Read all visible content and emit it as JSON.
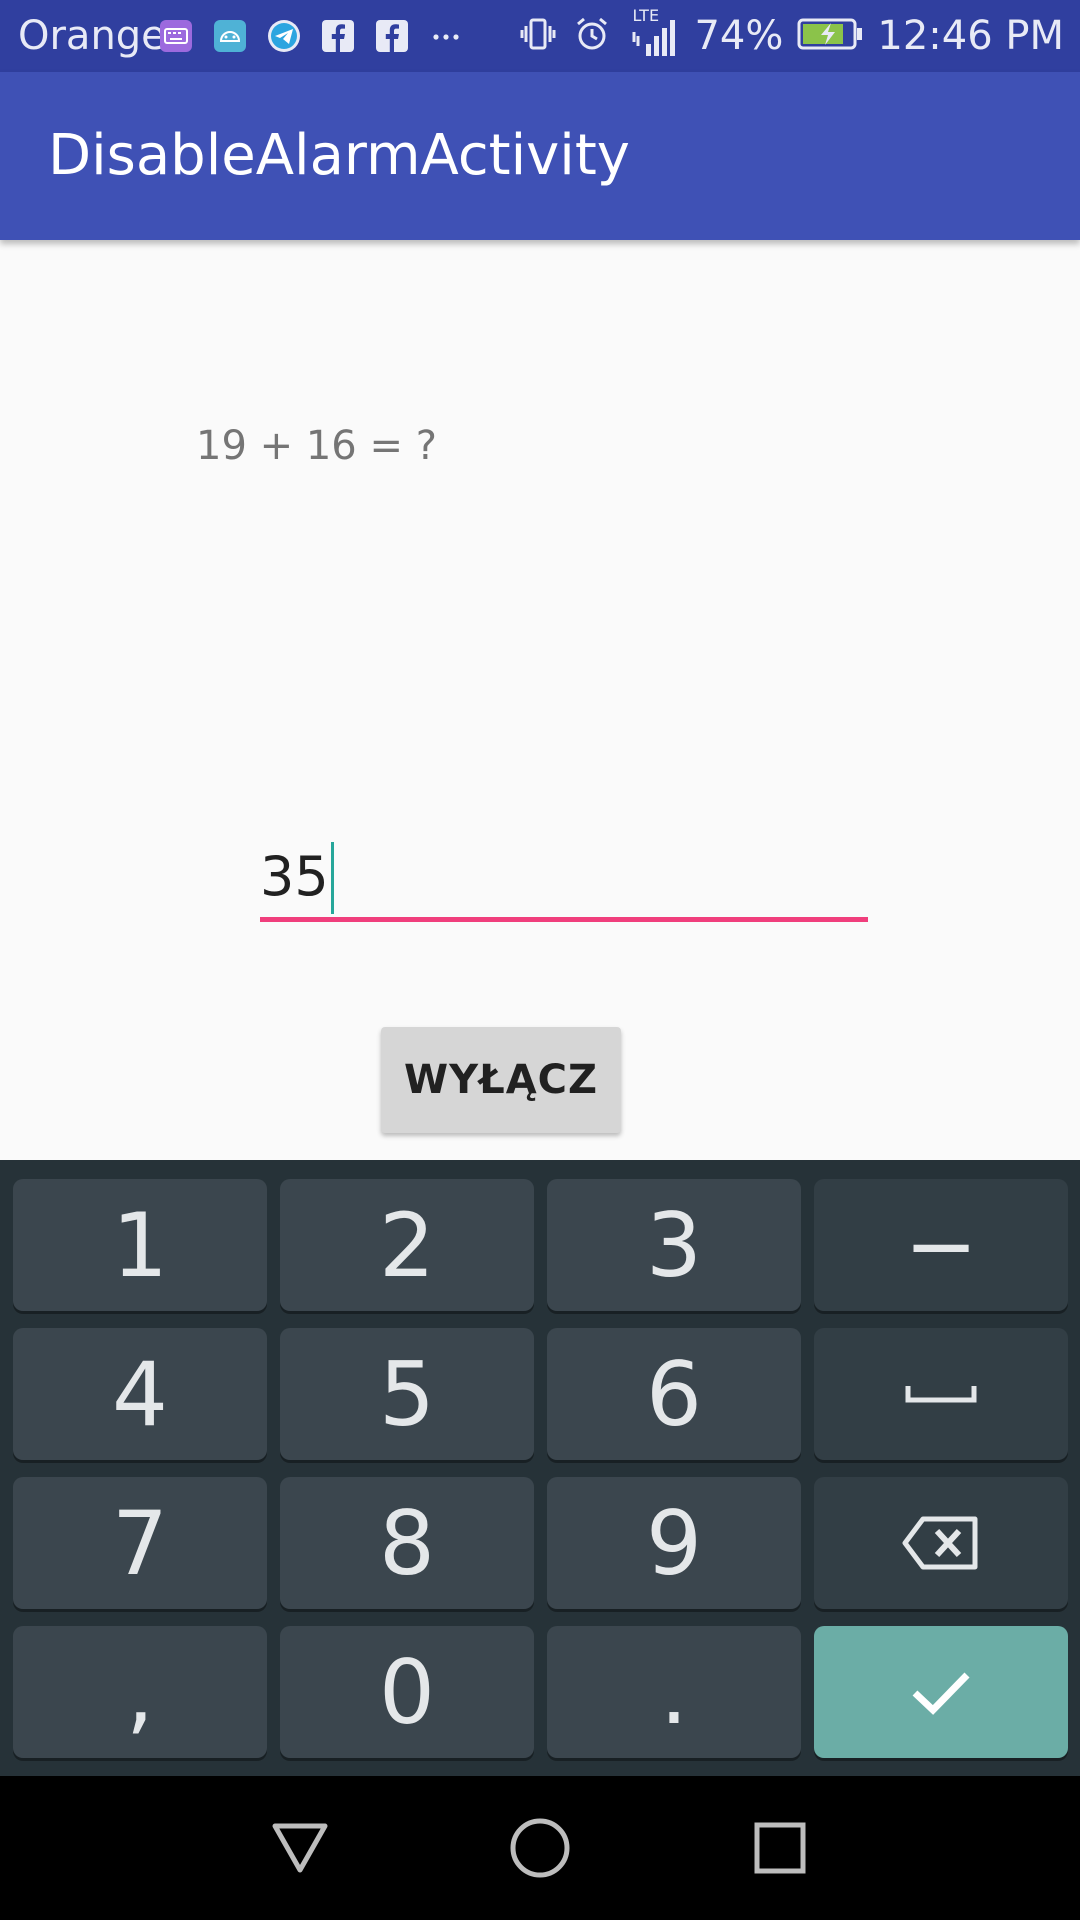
{
  "status_bar": {
    "carrier": "Orange",
    "notification_icons": [
      "keyboard-icon",
      "android-icon",
      "telegram-icon",
      "facebook-icon",
      "facebook-icon",
      "more-icon"
    ],
    "network": "LTE",
    "battery_percent": "74%",
    "time": "12:46 PM"
  },
  "app_bar": {
    "title": "DisableAlarmActivity"
  },
  "content": {
    "question": "19 + 16 = ?",
    "answer_value": "35",
    "button_label": "WYŁĄCZ"
  },
  "keyboard": {
    "keys": {
      "k1": "1",
      "k2": "2",
      "k3": "3",
      "minus": "−",
      "k4": "4",
      "k5": "5",
      "k6": "6",
      "k7": "7",
      "k8": "8",
      "k9": "9",
      "comma": ",",
      "k0": "0",
      "period": "."
    },
    "colors": {
      "background": "#263238",
      "key": "#3B464E",
      "enter": "#6BADA6"
    }
  },
  "colors": {
    "status_bar": "#303F9F",
    "app_bar": "#3F51B5",
    "field_underline": "#F03E7C",
    "caret": "#26A69A"
  }
}
